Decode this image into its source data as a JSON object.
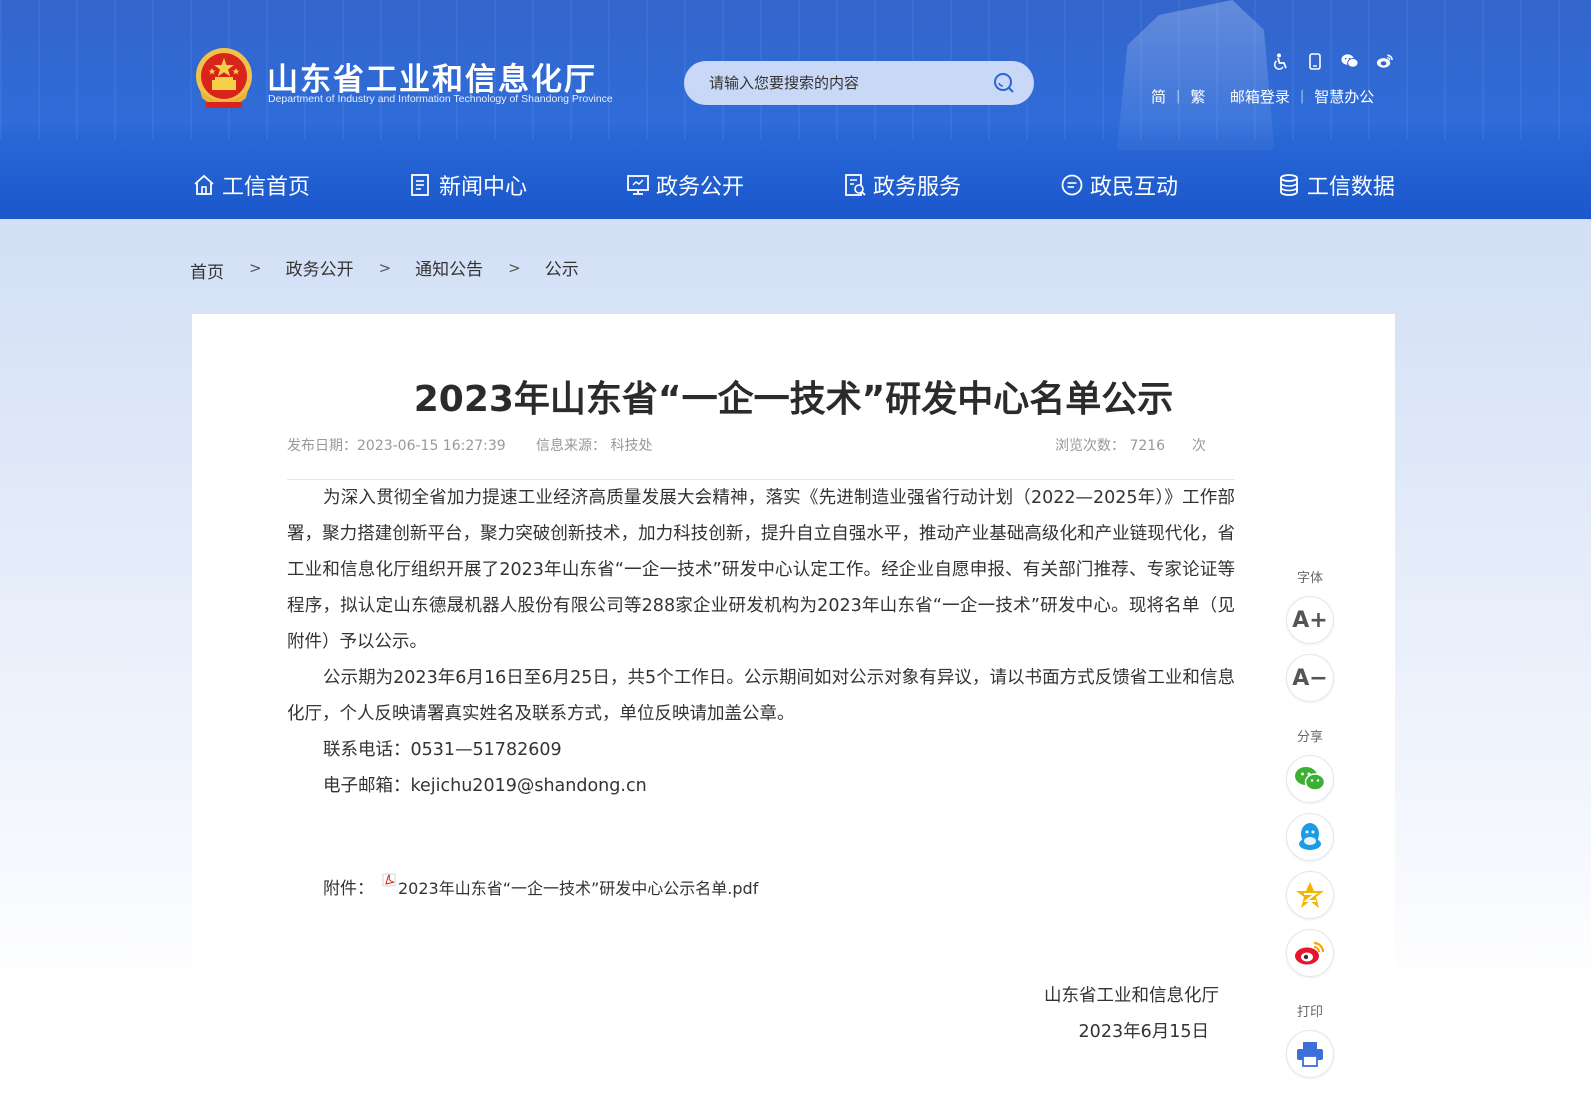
{
  "header": {
    "site_title": "山东省工业和信息化厅",
    "site_subtitle": "Department of Industry and Information Technology of Shandong Province",
    "search_placeholder": "请输入您要搜索的内容",
    "top_icons": [
      "accessibility-icon",
      "mobile-icon",
      "wechat-icon",
      "weibo-icon"
    ],
    "links": {
      "simplified": "简",
      "traditional": "繁",
      "mail_login": "邮箱登录",
      "smart_office": "智慧办公"
    }
  },
  "nav": {
    "items": [
      {
        "label": "工信首页",
        "icon": "home-icon"
      },
      {
        "label": "新闻中心",
        "icon": "news-icon"
      },
      {
        "label": "政务公开",
        "icon": "monitor-icon"
      },
      {
        "label": "政务服务",
        "icon": "service-icon"
      },
      {
        "label": "政民互动",
        "icon": "chat-icon"
      },
      {
        "label": "工信数据",
        "icon": "database-icon"
      }
    ]
  },
  "breadcrumb": {
    "items": [
      "首页",
      "政务公开",
      "通知公告",
      "公示"
    ],
    "separator": ">"
  },
  "article": {
    "title": "2023年山东省“一企一技术”研发中心名单公示",
    "meta": {
      "date_label": "发布日期：2023-06-15 16:27:39",
      "source_label": "信息来源：  科技处",
      "views_label": "浏览次数：  7216",
      "views_unit": "次"
    },
    "paragraphs": [
      "为深入贯彻全省加力提速工业经济高质量发展大会精神，落实《先进制造业强省行动计划（2022—2025年）》工作部署，聚力搭建创新平台，聚力突破创新技术，加力科技创新，提升自立自强水平，推动产业基础高级化和产业链现代化，省工业和信息化厅组织开展了2023年山东省“一企一技术”研发中心认定工作。经企业自愿申报、有关部门推荐、专家论证等程序，拟认定山东德晟机器人股份有限公司等288家企业研发机构为2023年山东省“一企一技术”研发中心。现将名单（见附件）予以公示。",
      "公示期为2023年6月16日至6月25日，共5个工作日。公示期间如对公示对象有异议，请以书面方式反馈省工业和信息化厅，个人反映请署真实姓名及联系方式，单位反映请加盖公章。",
      "联系电话：0531—51782609",
      "电子邮箱：kejichu2019@shandong.cn"
    ],
    "attachment_label": "附件：",
    "attachment_file": "2023年山东省“一企一技术”研发中心公示名单.pdf",
    "sign_org": "山东省工业和信息化厅",
    "sign_date": "2023年6月15日"
  },
  "sidebar": {
    "font_label": "字体",
    "font_increase": "A+",
    "font_decrease": "A−",
    "share_label": "分享",
    "share_icons": [
      "wechat-icon",
      "qq-icon",
      "qzone-icon",
      "weibo-icon"
    ],
    "print_label": "打印",
    "colors": {
      "wechat": "#3cb034",
      "qq": "#1a9de6",
      "qzone": "#f5b400",
      "weibo": "#e6162d",
      "print": "#3d6fd8"
    }
  }
}
